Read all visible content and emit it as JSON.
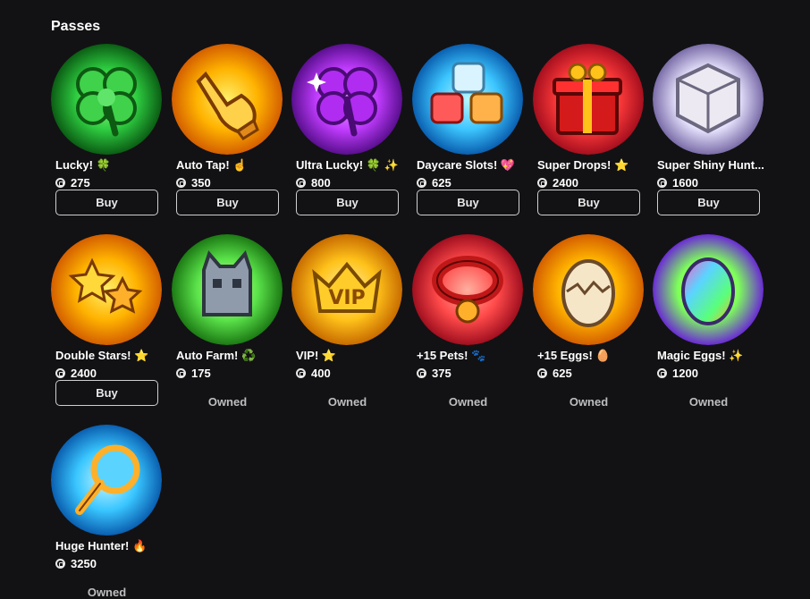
{
  "section": {
    "title": "Passes"
  },
  "passes": [
    {
      "name": "Lucky! 🍀",
      "price": "275",
      "action": "Buy",
      "icon": "clover-icon",
      "bg1": "#2ecc40",
      "bg2": "#0b5d14"
    },
    {
      "name": "Auto Tap! ☝️",
      "price": "350",
      "action": "Buy",
      "icon": "tap-hand-icon",
      "bg1": "#ffb300",
      "bg2": "#d45f00"
    },
    {
      "name": "Ultra Lucky! 🍀 ✨",
      "price": "800",
      "action": "Buy",
      "icon": "purple-clover-icon",
      "bg1": "#c13cff",
      "bg2": "#5a0f8f"
    },
    {
      "name": "Daycare Slots! 💖",
      "price": "625",
      "action": "Buy",
      "icon": "blocks-icon",
      "bg1": "#3cc6ff",
      "bg2": "#0a5fb0"
    },
    {
      "name": "Super Drops! ⭐",
      "price": "2400",
      "action": "Buy",
      "icon": "gift-box-icon",
      "bg1": "#ff3b3b",
      "bg2": "#a60f1e"
    },
    {
      "name": "Super Shiny Hunt...",
      "price": "1600",
      "action": "Buy",
      "icon": "shiny-cube-icon",
      "bg1": "#e9e6ff",
      "bg2": "#7a6ca8"
    },
    {
      "name": "Double Stars! ⭐",
      "price": "2400",
      "action": "Buy",
      "icon": "double-stars-icon",
      "bg1": "#ffb300",
      "bg2": "#d45f00"
    },
    {
      "name": "Auto Farm! ♻️",
      "price": "175",
      "action": "Owned",
      "icon": "cat-icon",
      "bg1": "#5be34a",
      "bg2": "#1c7a14"
    },
    {
      "name": "VIP! ⭐",
      "price": "400",
      "action": "Owned",
      "icon": "vip-crown-icon",
      "bg1": "#ffc21a",
      "bg2": "#c86c00"
    },
    {
      "name": "+15 Pets! 🐾",
      "price": "375",
      "action": "Owned",
      "icon": "pet-collar-icon",
      "bg1": "#ff4a4a",
      "bg2": "#a00f1f"
    },
    {
      "name": "+15 Eggs! 🥚",
      "price": "625",
      "action": "Owned",
      "icon": "egg-icon",
      "bg1": "#ffb300",
      "bg2": "#d45f00"
    },
    {
      "name": "Magic Eggs! ✨",
      "price": "1200",
      "action": "Owned",
      "icon": "magic-egg-icon",
      "bg1": "#7dff5a",
      "bg2": "#6a2ad4"
    },
    {
      "name": "Huge Hunter! 🔥",
      "price": "3250",
      "action": "Owned",
      "icon": "magnifier-icon",
      "bg1": "#39c6ff",
      "bg2": "#0a5fb0"
    }
  ]
}
